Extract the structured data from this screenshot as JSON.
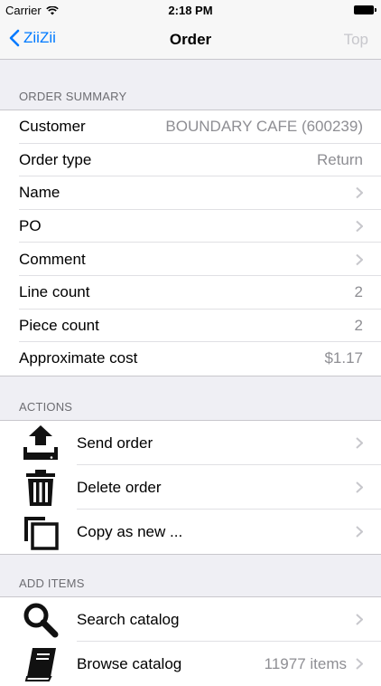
{
  "status_bar": {
    "carrier": "Carrier",
    "time": "2:18 PM"
  },
  "nav": {
    "back_label": "ZiiZii",
    "title": "Order",
    "right_label": "Top"
  },
  "order_summary": {
    "header": "ORDER SUMMARY",
    "rows": [
      {
        "label": "Customer",
        "value": "BOUNDARY CAFE (600239)"
      },
      {
        "label": "Order type",
        "value": "Return"
      },
      {
        "label": "Name",
        "value": ""
      },
      {
        "label": "PO",
        "value": ""
      },
      {
        "label": "Comment",
        "value": ""
      },
      {
        "label": "Line count",
        "value": "2"
      },
      {
        "label": "Piece count",
        "value": "2"
      },
      {
        "label": "Approximate cost",
        "value": "$1.17"
      }
    ]
  },
  "actions": {
    "header": "ACTIONS",
    "items": [
      {
        "label": "Send order",
        "icon": "upload-tray-icon"
      },
      {
        "label": "Delete order",
        "icon": "trash-icon"
      },
      {
        "label": "Copy as new ...",
        "icon": "copy-icon"
      }
    ]
  },
  "add_items": {
    "header": "ADD ITEMS",
    "items": [
      {
        "label": "Search catalog",
        "value": "",
        "icon": "magnifier-icon"
      },
      {
        "label": "Browse catalog",
        "value": "11977 items",
        "icon": "book-icon"
      }
    ]
  },
  "colors": {
    "accent": "#007aff",
    "secondary_text": "#8e8e93",
    "background": "#efeff4"
  }
}
